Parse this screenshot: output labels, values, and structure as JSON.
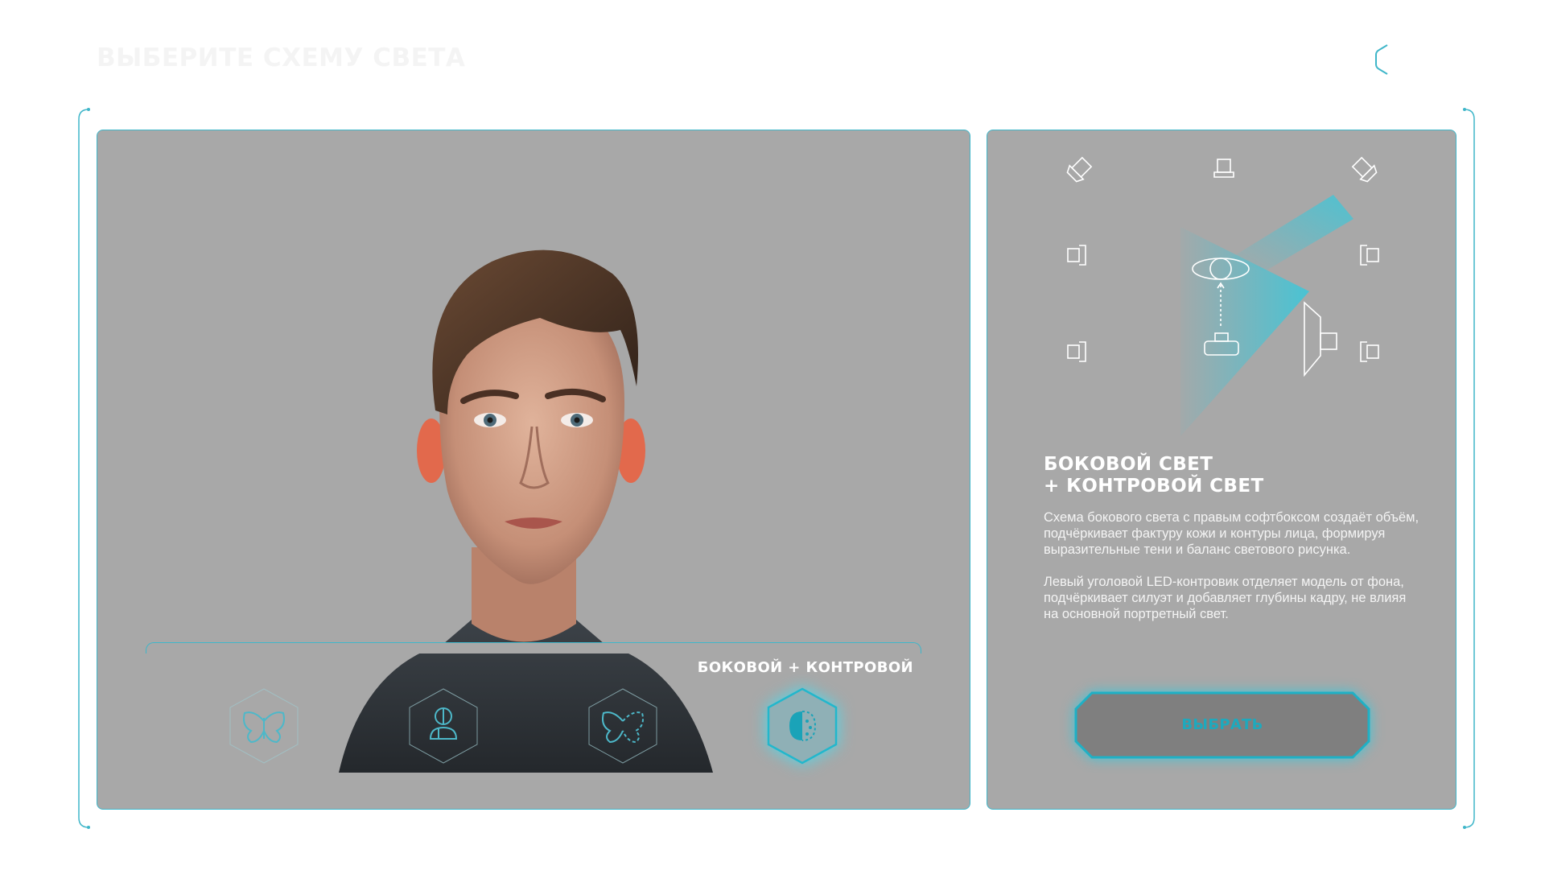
{
  "header": {
    "title": "ВЫБЕРИТЕ СХЕМУ СВЕТА",
    "back_icon": "chevron-left-icon"
  },
  "preview": {
    "selected_label": "БОКОВОЙ + КОНТРОВОЙ",
    "schemes": [
      {
        "icon": "butterfly-icon",
        "selected": false
      },
      {
        "icon": "portrait-light-icon",
        "selected": false
      },
      {
        "icon": "split-butterfly-icon",
        "selected": false
      },
      {
        "icon": "side-light-icon",
        "selected": true
      }
    ]
  },
  "details": {
    "title_line1": "БОКОВОЙ СВЕТ",
    "title_line2": "+ КОНТРОВОЙ СВЕТ",
    "paragraph1": "Схема бокового света с правым софтбоксом создаёт объём, подчёркивает фактуру кожи и контуры лица, формируя выразительные тени и баланс светового рисунка.",
    "paragraph2": "Левый уголовой LED-контровик отделяет модель от фона, подчёркивает силуэт и добавляет глубины кадру, не влияя на основной портретный свет.",
    "select_label": "ВЫБРАТЬ"
  },
  "colors": {
    "accent": "#3fb6c9",
    "panel": "#a8a8a8",
    "beam": "#4fc3d2"
  }
}
